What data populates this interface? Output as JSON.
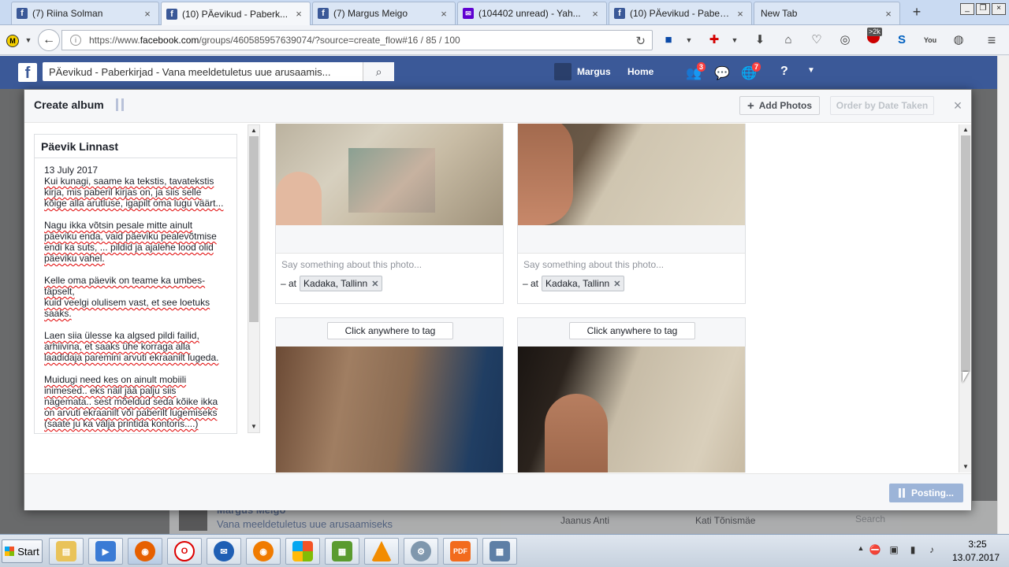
{
  "browser": {
    "tabs": [
      {
        "label": "(7) Riina Solman",
        "icon": "facebook-icon",
        "active": false
      },
      {
        "label": "(10) PÄevikud - Paberk...",
        "icon": "facebook-icon",
        "active": true
      },
      {
        "label": "(7) Margus Meigo",
        "icon": "facebook-icon",
        "active": false
      },
      {
        "label": "(104402 unread) - Yah...",
        "icon": "mail-icon",
        "active": false
      },
      {
        "label": "(10) PÄevikud - Paberk...",
        "icon": "facebook-icon",
        "active": false
      },
      {
        "label": "New Tab",
        "icon": "",
        "active": false
      }
    ],
    "url_prefix": "https://www.",
    "url_domain": "facebook.com",
    "url_rest": "/groups/460585957639074/?source=create_flow#16 / 85 / 100",
    "extension_badge": ">2k"
  },
  "facebook": {
    "search_value": "PÄevikud - Paberkirjad - Vana meeldetuletus uue arusaamis...",
    "user_name": "Margus",
    "home_label": "Home",
    "friend_requests_badge": "3",
    "notifications_badge": "7",
    "bottom_author": "Margus Meigo",
    "bottom_group": "Vana meeldetuletus uue arusaamiseks",
    "bottom_contact_1": "Jaanus Anti",
    "bottom_contact_2": "Kati Tõnismäe",
    "bottom_search_placeholder": "Search"
  },
  "dialog": {
    "title": "Create album",
    "add_photos_label": "Add Photos",
    "order_label": "Order by Date Taken",
    "close_label": "×",
    "album_name": "Päevik Linnast",
    "album_date": "13 July 2017",
    "description_paragraphs": [
      [
        "Kui kunagi, saame ka tekstis, tavatekstis",
        "kirja, mis paberil kirjas on, ja siis selle",
        "kõige alla arutluse, igapilt oma lugu väärt..."
      ],
      [
        "Nagu ikka võtsin pesale mitte ainult",
        "päeviku enda, vaid päeviku pealevõtmise",
        "endi ka suts, ... pildid ja ajalehe lood olid",
        "päeviku vahel."
      ],
      [
        "Kelle oma päevik on teame ka umbes-",
        "täpselt,",
        "kuid veelgi olulisem vast, et see loetuks",
        "saaks."
      ],
      [
        "Laen siia ülesse ka algsed pildi failid,",
        "arhiivina, et saaks ühe korraga alla",
        "laadidaja paremini arvuti ekraanilt lugeda."
      ],
      [
        "Muidugi need kes on ainult mobiili",
        "inimesed.. eks näil jää palju siis",
        "nägemata.. sest mõeldud seda kõike ikka",
        "on arvuti ekraanilt või paberilt lugemiseks",
        "(saate ju ka välja printida kontoris....)"
      ]
    ],
    "caption_placeholder": "Say something about this photo...",
    "at_label": "– at",
    "location_tag": "Kadaka, Tallinn",
    "tag_button_label": "Click anywhere to tag",
    "posting_label": "Posting..."
  },
  "taskbar": {
    "start_label": "Start",
    "apps": [
      "file-explorer-icon",
      "media-player-icon",
      "firefox-icon",
      "opera-icon",
      "thunderbird-icon",
      "firefox-icon",
      "windows-explorer-icon",
      "spreadsheet-icon",
      "vlc-icon",
      "network-icon",
      "pdf-icon",
      "calculator-icon"
    ],
    "clock_time": "3:25",
    "clock_date": "13.07.2017"
  },
  "colors": {
    "facebook_blue": "#3b5998",
    "posting_button": "#9cb4d8",
    "tab_bar": "#c9daf2"
  }
}
